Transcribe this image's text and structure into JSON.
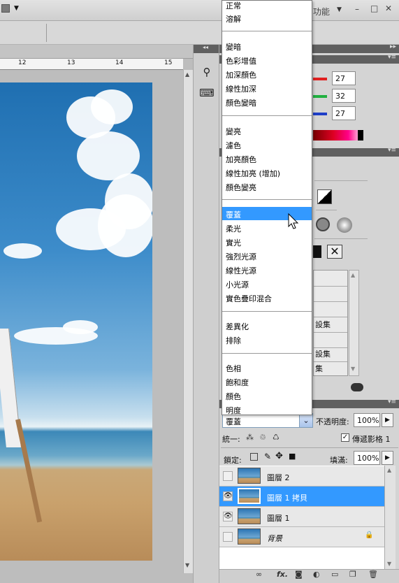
{
  "topbar": {
    "workspace_label": "功能",
    "minimize": "–",
    "restore": "□",
    "close": "✕"
  },
  "ruler": {
    "marks": [
      "12",
      "13",
      "14",
      "15"
    ]
  },
  "color_panel": {
    "values": [
      "27",
      "32",
      "27"
    ],
    "colors": [
      "#e02020",
      "#20b040",
      "#1e3ec8"
    ]
  },
  "blend_menu": {
    "groups": [
      [
        "正常",
        "溶解"
      ],
      [
        "變暗",
        "色彩增值",
        "加深顏色",
        "線性加深",
        "顏色變暗"
      ],
      [
        "變亮",
        "濾色",
        "加亮顏色",
        "線性加亮 (增加)",
        "顏色變亮"
      ],
      [
        "覆蓋",
        "柔光",
        "實光",
        "強烈光源",
        "線性光源",
        "小光源",
        "實色疊印混合"
      ],
      [
        "差異化",
        "排除"
      ],
      [
        "色相",
        "飽和度",
        "顏色",
        "明度"
      ]
    ],
    "highlighted": "覆蓋"
  },
  "partial_panel": {
    "rows": [
      "設集",
      "設集",
      "集"
    ]
  },
  "layers": {
    "blend_value": "覆蓋",
    "opacity_label": "不透明度:",
    "opacity_value": "100%",
    "unify_label": "統一:",
    "propagate_label": "傳遞影格 1",
    "lock_label": "鎖定:",
    "fill_label": "填滿:",
    "fill_value": "100%",
    "rows": [
      {
        "name": "圖層 2",
        "visible": false,
        "selected": false
      },
      {
        "name": "圖層 1 拷貝",
        "visible": true,
        "selected": true
      },
      {
        "name": "圖層 1",
        "visible": true,
        "selected": false
      },
      {
        "name": "背景",
        "visible": false,
        "selected": false
      }
    ]
  },
  "icons": {
    "eye": "👁",
    "lock": "🔒"
  }
}
